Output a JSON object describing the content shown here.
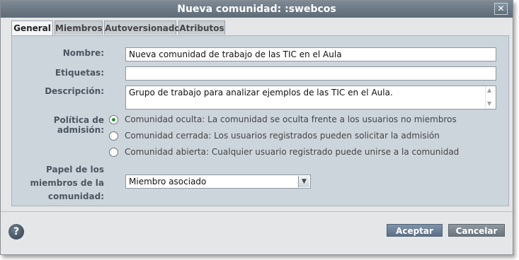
{
  "dialog": {
    "title": "Nueva comunidad: :swebcos",
    "close_label": "✕"
  },
  "tabs": [
    {
      "label": "General",
      "active": true
    },
    {
      "label": "Miembros",
      "active": false
    },
    {
      "label": "Autoversionado",
      "active": false
    },
    {
      "label": "Atributos",
      "active": false
    }
  ],
  "form": {
    "name_label": "Nombre:",
    "name_value": "Nueva comunidad de trabajo de las TIC en el Aula",
    "tags_label": "Etiquetas:",
    "tags_value": "",
    "description_label": "Descripción:",
    "description_value": "Grupo de trabajo para analizar ejemplos de las TIC en el Aula.",
    "policy_label": "Política de admisión:",
    "policy_options": [
      {
        "label": "Comunidad oculta: La comunidad se oculta frente a los usuarios no miembros",
        "selected": true
      },
      {
        "label": "Comunidad cerrada: Los usuarios registrados pueden solicitar la admisión",
        "selected": false
      },
      {
        "label": "Comunidad abierta: Cualquier usuario registrado puede unirse a la comunidad",
        "selected": false
      }
    ],
    "role_label_line1": "Papel de los",
    "role_label_line2": "miembros de la",
    "role_label_line3": "comunidad:",
    "role_value": "Miembro asociado"
  },
  "footer": {
    "help_label": "?",
    "accept_label": "Aceptar",
    "cancel_label": "Cancelar"
  }
}
